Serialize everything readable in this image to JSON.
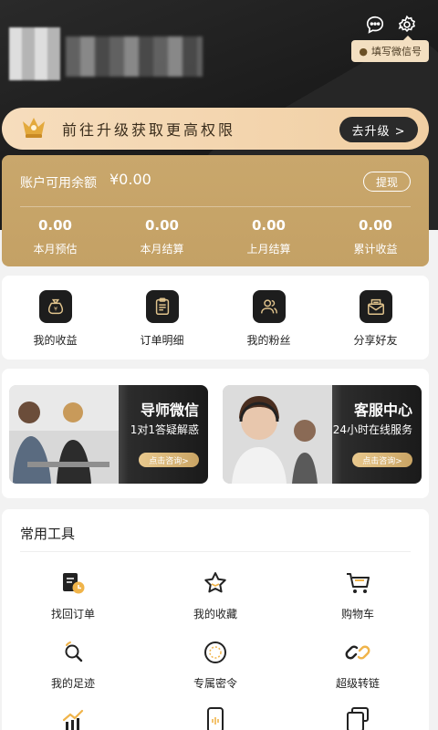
{
  "header": {
    "wechat_tag": "填写微信号",
    "icons": [
      "message-icon",
      "gear-icon"
    ]
  },
  "upgrade": {
    "text": "前往升级获取更高权限",
    "button": "去升级 >"
  },
  "balance": {
    "label": "账户可用余额",
    "value": "¥0.00",
    "withdraw": "提现",
    "stats": [
      {
        "value": "0.00",
        "label": "本月预估"
      },
      {
        "value": "0.00",
        "label": "本月结算"
      },
      {
        "value": "0.00",
        "label": "上月结算"
      },
      {
        "value": "0.00",
        "label": "累计收益"
      }
    ]
  },
  "quick": [
    {
      "label": "我的收益",
      "icon": "money-bag-icon"
    },
    {
      "label": "订单明细",
      "icon": "clipboard-icon"
    },
    {
      "label": "我的粉丝",
      "icon": "users-icon"
    },
    {
      "label": "分享好友",
      "icon": "envelope-icon"
    }
  ],
  "banners": [
    {
      "title": "导师微信",
      "sub": "1对1答疑解惑",
      "button": "点击咨询>"
    },
    {
      "title": "客服中心",
      "sub": "24小时在线服务",
      "button": "点击咨询>"
    }
  ],
  "tools": {
    "title": "常用工具",
    "items": [
      {
        "label": "找回订单",
        "icon": "order-recover-icon"
      },
      {
        "label": "我的收藏",
        "icon": "star-icon"
      },
      {
        "label": "购物车",
        "icon": "cart-icon"
      },
      {
        "label": "我的足迹",
        "icon": "footprint-icon"
      },
      {
        "label": "专属密令",
        "icon": "secret-code-icon"
      },
      {
        "label": "超级转链",
        "icon": "link-icon"
      },
      {
        "label": "",
        "icon": "trend-icon"
      },
      {
        "label": "",
        "icon": "phone-icon"
      },
      {
        "label": "",
        "icon": "cards-icon"
      }
    ]
  },
  "colors": {
    "gold": "#c9a76c",
    "dark": "#1b1b1b",
    "accent": "#f1cfa3"
  }
}
